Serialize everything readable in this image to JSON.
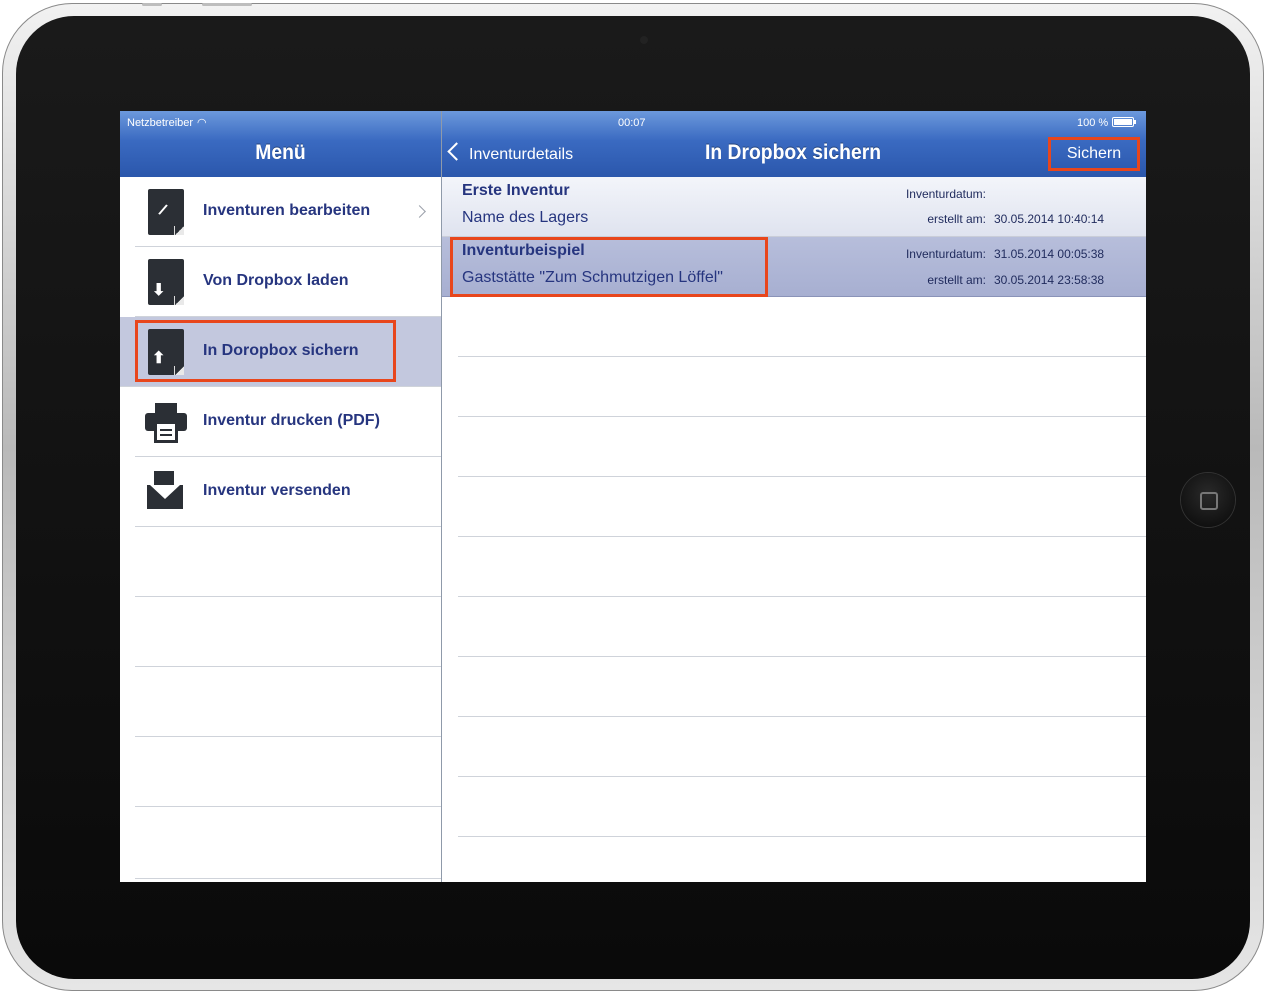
{
  "status_bar": {
    "carrier": "Netzbetreiber",
    "time": "00:07",
    "battery": "100 %"
  },
  "left_nav": {
    "title": "Menü"
  },
  "right_nav": {
    "back_label": "Inventurdetails",
    "title": "In Dropbox sichern",
    "save_label": "Sichern"
  },
  "menu": {
    "items": [
      {
        "label": "Inventuren bearbeiten",
        "icon": "edit-document-icon"
      },
      {
        "label": "Von Dropbox laden",
        "icon": "download-document-icon"
      },
      {
        "label": "In Doropbox sichern",
        "icon": "upload-document-icon"
      },
      {
        "label": "Inventur drucken (PDF)",
        "icon": "printer-icon"
      },
      {
        "label": "Inventur versenden",
        "icon": "envelope-icon"
      }
    ]
  },
  "inventories": [
    {
      "name": "Erste Inventur",
      "location": "Name des Lagers",
      "date_label": "Inventurdatum:",
      "date_value": "",
      "created_label": "erstellt am:",
      "created_value": "30.05.2014 10:40:14"
    },
    {
      "name": "Inventurbeispiel",
      "location": "Gaststätte \"Zum Schmutzigen Löffel\"",
      "date_label": "Inventurdatum:",
      "date_value": "31.05.2014 00:05:38",
      "created_label": "erstellt am:",
      "created_value": "30.05.2014 23:58:38"
    }
  ],
  "colors": {
    "accent_text": "#26357f",
    "highlight_border": "#e8461c",
    "nav_blue": "#3a6ac1",
    "selected_bg": "#c3c8de"
  }
}
